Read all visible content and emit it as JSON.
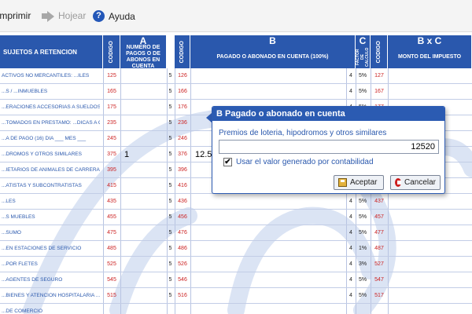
{
  "toolbar": {
    "print_label": "Imprimir",
    "browse_label": "Hojear",
    "help_label": "Ayuda"
  },
  "form": {
    "headers": {
      "concept": "SUJETOS A RETENCION",
      "codigo": "CODIGO",
      "col_a_letter": "A",
      "col_a_sub": "NUMERO DE PAGOS O DE ABONOS EN CUENTA",
      "col_b_letter": "B",
      "col_b_sub": "PAGADO O ABONADO EN CUENTA (100%)",
      "col_c_letter": "C",
      "col_c_sub": "FACTOR DE CALCULO",
      "col_bxc_letter": "B x C",
      "col_bxc_sub": "MONTO DEL IMPUESTO"
    },
    "rows": [
      {
        "concept": "ACTIVOS NO MERCANTILES: ...ILES",
        "code": "125",
        "four": "5",
        "code2": "126",
        "b4": "4",
        "pct": "5%",
        "code3": "127"
      },
      {
        "concept": "...S / ...INMUEBLES",
        "code": "165",
        "four": "5",
        "code2": "166",
        "b4": "4",
        "pct": "5%",
        "code3": "167"
      },
      {
        "concept": "...ERACIONES ACCESORIAS A SUELDOS",
        "code": "175",
        "four": "5",
        "code2": "176",
        "b4": "4",
        "pct": "5%",
        "code3": "177"
      },
      {
        "concept": "...TOMADOS EN PRESTAMO: ...DICAS A OTRA PERSONA O COMUNIDAD",
        "code": "235",
        "four": "5",
        "code2": "236",
        "b4": "4",
        "pct": "5%",
        "code3": "237"
      },
      {
        "concept": "...A DE PAGO (16) DIA ___ MES ___",
        "code": "245",
        "four": "5",
        "code2": "246",
        "b4": "4",
        "pct": "5%",
        "code3": "247"
      },
      {
        "concept": "...DROMOS Y OTROS SIMILARES",
        "code": "375",
        "four": "5",
        "code2": "376",
        "b4": "4",
        "pct": "5%",
        "code3": "377",
        "val_a": "1",
        "val_b": "12.52"
      },
      {
        "concept": "...IETARIOS DE ANIMALES DE CARRERA",
        "code": "395",
        "four": "5",
        "code2": "396",
        "b4": "4",
        "pct": "5%",
        "code3": "397"
      },
      {
        "concept": "...ATISTAS Y SUBCONTRATISTAS",
        "code": "415",
        "four": "5",
        "code2": "416",
        "b4": "4",
        "pct": "5%",
        "code3": "417"
      },
      {
        "concept": "...LES",
        "code": "435",
        "four": "5",
        "code2": "436",
        "b4": "4",
        "pct": "5%",
        "code3": "437"
      },
      {
        "concept": "...S MUEBLES",
        "code": "455",
        "four": "5",
        "code2": "456",
        "b4": "4",
        "pct": "5%",
        "code3": "457"
      },
      {
        "concept": "...SUMO",
        "code": "475",
        "four": "5",
        "code2": "476",
        "b4": "4",
        "pct": "5%",
        "code3": "477"
      },
      {
        "concept": "...EN ESTACIONES DE SERVICIO",
        "code": "485",
        "four": "5",
        "code2": "486",
        "b4": "4",
        "pct": "1%",
        "code3": "487"
      },
      {
        "concept": "...POR FLETES",
        "code": "525",
        "four": "5",
        "code2": "526",
        "b4": "4",
        "pct": "3%",
        "code3": "527"
      },
      {
        "concept": "...AGENTES DE SEGURO",
        "code": "545",
        "four": "5",
        "code2": "546",
        "b4": "4",
        "pct": "5%",
        "code3": "547"
      },
      {
        "concept": "...BIENES Y ATENCION HOSPITALARIA ...R EMPRESAS DE SEGUROS",
        "code": "515",
        "four": "5",
        "code2": "516",
        "b4": "4",
        "pct": "5%",
        "code3": "517"
      },
      {
        "concept": "...DE COMERCIO",
        "code": "",
        "four": "",
        "code2": "",
        "b4": "",
        "pct": "",
        "code3": ""
      }
    ]
  },
  "dialog": {
    "title": "B Pagado o abonado en cuenta",
    "field_label": "Premios de loteria, hipodromos y otros similares",
    "field_value": "12520",
    "checkbox_label": "Usar el valor generado por contabilidad",
    "checkbox_checked": true,
    "ok_label": "Aceptar",
    "cancel_label": "Cancelar"
  }
}
